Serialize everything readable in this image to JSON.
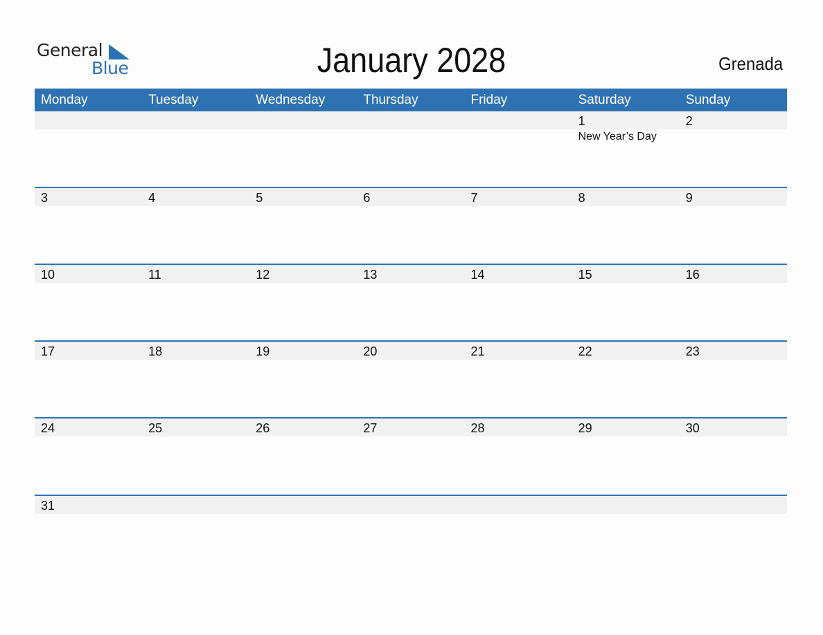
{
  "logo": {
    "line1": "General",
    "line2": "Blue",
    "icon": "triangle-icon"
  },
  "title": "January 2028",
  "country": "Grenada",
  "colors": {
    "accent": "#2e72b3",
    "stripe": "#f1f1f1"
  },
  "weekdays": [
    "Monday",
    "Tuesday",
    "Wednesday",
    "Thursday",
    "Friday",
    "Saturday",
    "Sunday"
  ],
  "weeks": [
    [
      {
        "day": ""
      },
      {
        "day": ""
      },
      {
        "day": ""
      },
      {
        "day": ""
      },
      {
        "day": ""
      },
      {
        "day": "1",
        "event": "New Year’s Day"
      },
      {
        "day": "2"
      }
    ],
    [
      {
        "day": "3"
      },
      {
        "day": "4"
      },
      {
        "day": "5"
      },
      {
        "day": "6"
      },
      {
        "day": "7"
      },
      {
        "day": "8"
      },
      {
        "day": "9"
      }
    ],
    [
      {
        "day": "10"
      },
      {
        "day": "11"
      },
      {
        "day": "12"
      },
      {
        "day": "13"
      },
      {
        "day": "14"
      },
      {
        "day": "15"
      },
      {
        "day": "16"
      }
    ],
    [
      {
        "day": "17"
      },
      {
        "day": "18"
      },
      {
        "day": "19"
      },
      {
        "day": "20"
      },
      {
        "day": "21"
      },
      {
        "day": "22"
      },
      {
        "day": "23"
      }
    ],
    [
      {
        "day": "24"
      },
      {
        "day": "25"
      },
      {
        "day": "26"
      },
      {
        "day": "27"
      },
      {
        "day": "28"
      },
      {
        "day": "29"
      },
      {
        "day": "30"
      }
    ],
    [
      {
        "day": "31"
      },
      {
        "day": ""
      },
      {
        "day": ""
      },
      {
        "day": ""
      },
      {
        "day": ""
      },
      {
        "day": ""
      },
      {
        "day": ""
      }
    ]
  ]
}
